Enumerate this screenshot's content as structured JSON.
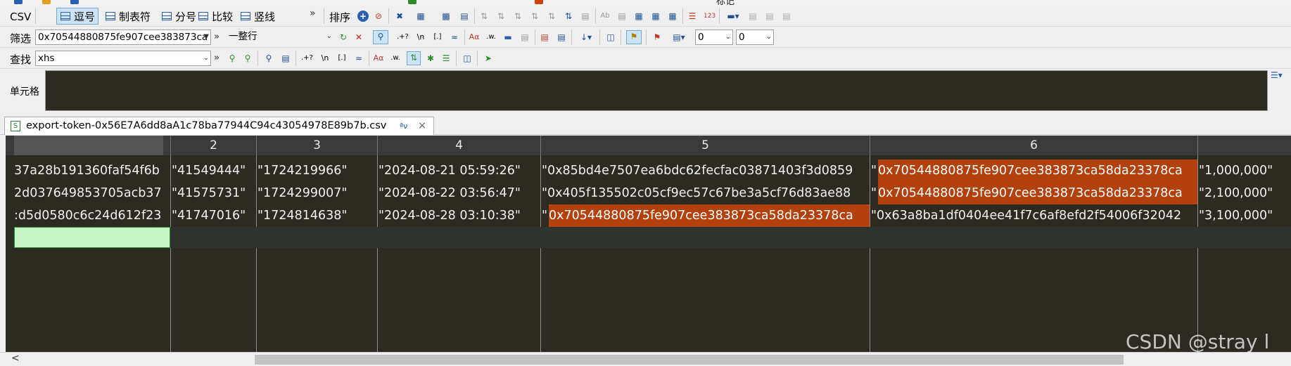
{
  "top_strip": {
    "label": "标记"
  },
  "toolbar1": {
    "csv_label": "CSV",
    "buttons": [
      {
        "label": "逗号",
        "active": true
      },
      {
        "label": "制表符",
        "active": false
      },
      {
        "label": "分号",
        "active": false
      },
      {
        "label": "比较",
        "active": false
      },
      {
        "label": "竖线",
        "active": false
      }
    ],
    "more": "»",
    "sort_label": "排序"
  },
  "filter_bar": {
    "label": "筛选",
    "value": "0x70544880875fe907cee383873ca",
    "mode": "一整行",
    "num1": "0",
    "num2": "0",
    "icons": [
      ".+?",
      "\\n",
      "[.]",
      "≈"
    ]
  },
  "find_bar": {
    "label": "查找",
    "value": "xhs",
    "icons": [
      ".+?",
      "\\n",
      "[.]",
      "≈"
    ]
  },
  "cell_bar": {
    "label": "单元格"
  },
  "tab": {
    "icon": "S",
    "title": "export-token-0x56E7A6dd8aA1c78ba77944C94c43054978E89b7b.csv",
    "pin": "ªν",
    "close": "×"
  },
  "grid": {
    "headers": [
      "",
      "2",
      "3",
      "4",
      "5",
      "6",
      ""
    ],
    "rows": [
      [
        "37a28b191360faf54f6b",
        "\"41549444\"",
        "\"1724219966\"",
        "\"2024-08-21 05:59:26\"",
        "\"0x85bd4e7507ea6bdc62fecfac03871403f3d0859",
        "\"",
        "0x70544880875fe907cee383873ca58da23378ca",
        "\"1,000,000\""
      ],
      [
        "2d037649853705acb37",
        "\"41575731\"",
        "\"1724299007\"",
        "\"2024-08-22 03:56:47\"",
        "\"0x405f135502c05cf9ec57c67be3a5cf76d83ae88",
        "\"",
        "0x70544880875fe907cee383873ca58da23378ca",
        "\"2,100,000\""
      ],
      [
        ":d5d0580c6c24d612f23",
        "\"41747016\"",
        "\"1724814638\"",
        "\"2024-08-28 03:10:38\"",
        "\"",
        "0x70544880875fe907cee383873ca58da23378ca",
        "\"0x63a8ba1df0404ee41f7c6af8efd2f54006f32042",
        "\"3,100,000\""
      ]
    ]
  },
  "scroll": {
    "left_arrow": "<"
  },
  "watermark": "CSDN @stray l"
}
